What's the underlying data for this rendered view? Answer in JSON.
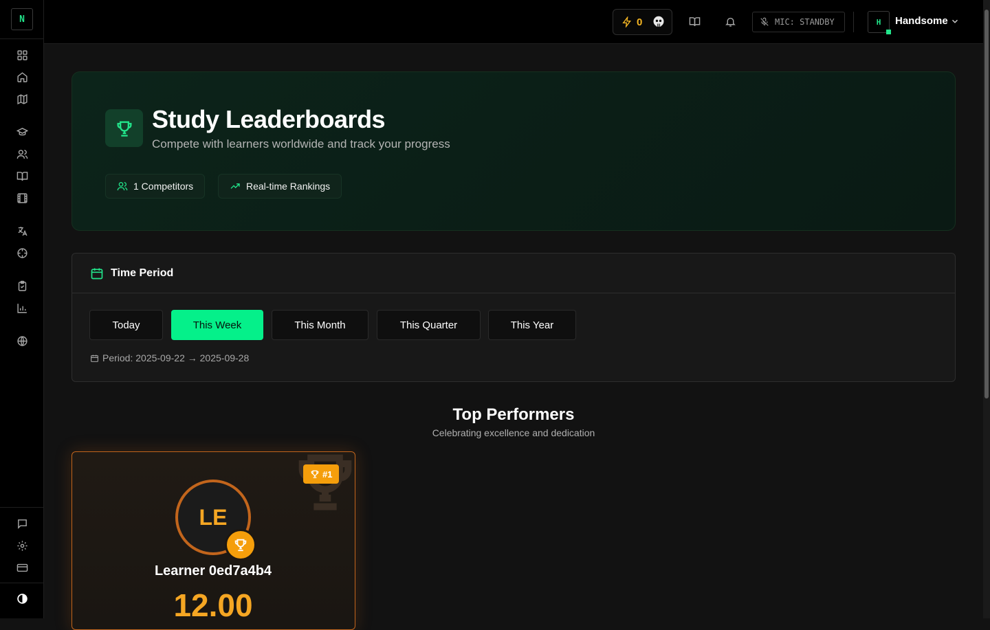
{
  "sidebar": {
    "logo": "N",
    "items": [
      {
        "icon": "dashboard-icon"
      },
      {
        "icon": "home-icon"
      },
      {
        "icon": "map-icon"
      },
      {
        "icon": "graduation-cap-icon"
      },
      {
        "icon": "users-icon"
      },
      {
        "icon": "book-open-icon"
      },
      {
        "icon": "film-icon"
      },
      {
        "icon": "translate-icon"
      },
      {
        "icon": "target-icon"
      },
      {
        "icon": "clipboard-icon"
      },
      {
        "icon": "bar-chart-icon"
      },
      {
        "icon": "globe-icon"
      }
    ],
    "bottom": [
      {
        "icon": "message-icon"
      },
      {
        "icon": "settings-icon"
      },
      {
        "icon": "credit-card-icon"
      },
      {
        "icon": "theme-toggle-icon"
      }
    ]
  },
  "header": {
    "points": "0",
    "mic": "MIC: STANDBY",
    "avatar_initial": "H",
    "username": "Handsome"
  },
  "hero": {
    "title": "Study Leaderboards",
    "subtitle": "Compete with learners worldwide and track your progress",
    "chip_competitors": "1 Competitors",
    "chip_realtime": "Real-time Rankings"
  },
  "period": {
    "title": "Time Period",
    "buttons": [
      "Today",
      "This Week",
      "This Month",
      "This Quarter",
      "This Year"
    ],
    "active": "This Week",
    "range": "Period: 2025-09-22 → 2025-09-28"
  },
  "top_performers": {
    "title": "Top Performers",
    "subtitle": "Celebrating excellence and dedication",
    "cards": [
      {
        "rank": "#1",
        "initials": "LE",
        "name": "Learner 0ed7a4b4",
        "score": "12.00"
      }
    ]
  },
  "colors": {
    "accent": "#05f08a",
    "gold": "#f59e0b",
    "bronze_border": "#c2651c",
    "points": "#f5b623"
  }
}
